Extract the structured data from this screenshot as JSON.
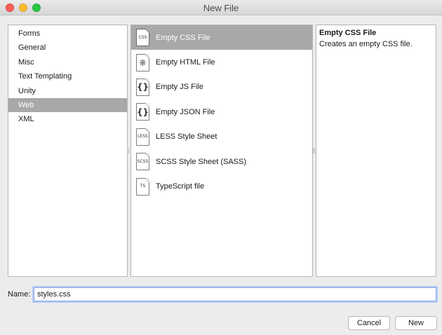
{
  "window": {
    "title": "New File"
  },
  "categories": [
    {
      "label": "Forms",
      "selected": false
    },
    {
      "label": "General",
      "selected": false
    },
    {
      "label": "Misc",
      "selected": false
    },
    {
      "label": "Text Templating",
      "selected": false
    },
    {
      "label": "Unity",
      "selected": false
    },
    {
      "label": "Web",
      "selected": true
    },
    {
      "label": "XML",
      "selected": false
    }
  ],
  "templates": [
    {
      "label": "Empty CSS File",
      "icon": "css-file-icon",
      "icon_text": "CSS",
      "selected": true
    },
    {
      "label": "Empty HTML File",
      "icon": "html-file-icon",
      "icon_text": "⎈",
      "selected": false
    },
    {
      "label": "Empty JS File",
      "icon": "js-file-icon",
      "icon_text": "{}",
      "selected": false
    },
    {
      "label": "Empty JSON File",
      "icon": "json-file-icon",
      "icon_text": "{}",
      "selected": false
    },
    {
      "label": "LESS Style Sheet",
      "icon": "less-file-icon",
      "icon_text": "LESS",
      "selected": false
    },
    {
      "label": "SCSS Style Sheet (SASS)",
      "icon": "scss-file-icon",
      "icon_text": "SCSS",
      "selected": false
    },
    {
      "label": "TypeScript file",
      "icon": "ts-file-icon",
      "icon_text": "TS",
      "selected": false
    }
  ],
  "description": {
    "title": "Empty CSS File",
    "text": "Creates an empty CSS file."
  },
  "name_field": {
    "label": "Name:",
    "value": "styles.css"
  },
  "buttons": {
    "cancel": "Cancel",
    "new": "New"
  },
  "colors": {
    "selection": "#a8a8a8",
    "focus_ring": "#8aa8ea"
  }
}
